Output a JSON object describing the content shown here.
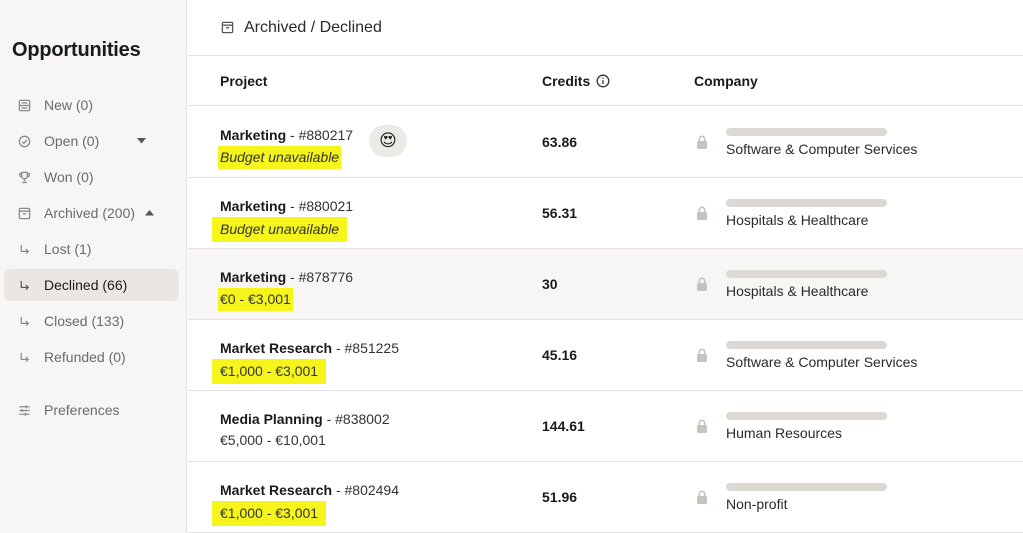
{
  "sidebar": {
    "title": "Opportunities",
    "items": [
      {
        "label": "New (0)",
        "icon": "inbox-icon"
      },
      {
        "label": "Open (0)",
        "icon": "check-circle-icon"
      },
      {
        "label": "Won (0)",
        "icon": "trophy-icon"
      },
      {
        "label": "Archived (200)",
        "icon": "archive-icon"
      },
      {
        "label": "Lost (1)",
        "icon": "sub-arrow-icon"
      },
      {
        "label": "Declined (66)",
        "icon": "sub-arrow-icon",
        "active": true
      },
      {
        "label": "Closed (133)",
        "icon": "sub-arrow-icon"
      },
      {
        "label": "Refunded (0)",
        "icon": "sub-arrow-icon"
      },
      {
        "label": "Preferences",
        "icon": "sliders-icon"
      }
    ]
  },
  "header": {
    "breadcrumb": "Archived / Declined",
    "icon": "archive-icon"
  },
  "table": {
    "columns": {
      "project": "Project",
      "credits": "Credits",
      "company": "Company"
    },
    "rows": [
      {
        "name": "Marketing",
        "id": " - #880217",
        "sub": "Budget unavailable",
        "credits": "63.86",
        "company": "Software & Computer Services"
      },
      {
        "name": "Marketing",
        "id": " - #880021",
        "sub": "Budget unavailable",
        "credits": "56.31",
        "company": "Hospitals & Healthcare"
      },
      {
        "name": "Marketing",
        "id": " - #878776",
        "sub": "€0 - €3,001",
        "credits": "30",
        "company": "Hospitals & Healthcare"
      },
      {
        "name": "Market Research",
        "id": " - #851225",
        "sub": "€1,000 - €3,001",
        "credits": "45.16",
        "company": "Software & Computer Services"
      },
      {
        "name": "Media Planning",
        "id": " - #838002",
        "sub": "€5,000 - €10,001",
        "credits": "144.61",
        "company": "Human Resources"
      },
      {
        "name": "Market Research",
        "id": " - #802494",
        "sub": "€1,000 - €3,001",
        "credits": "51.96",
        "company": "Non-profit"
      }
    ]
  },
  "colors": {
    "highlight": "#f6f51b",
    "sidebar_bg": "#f7f6f5",
    "active_bg": "#e9e6e3",
    "placeholder_bar": "#dcd9d5"
  },
  "emoji": "😍"
}
